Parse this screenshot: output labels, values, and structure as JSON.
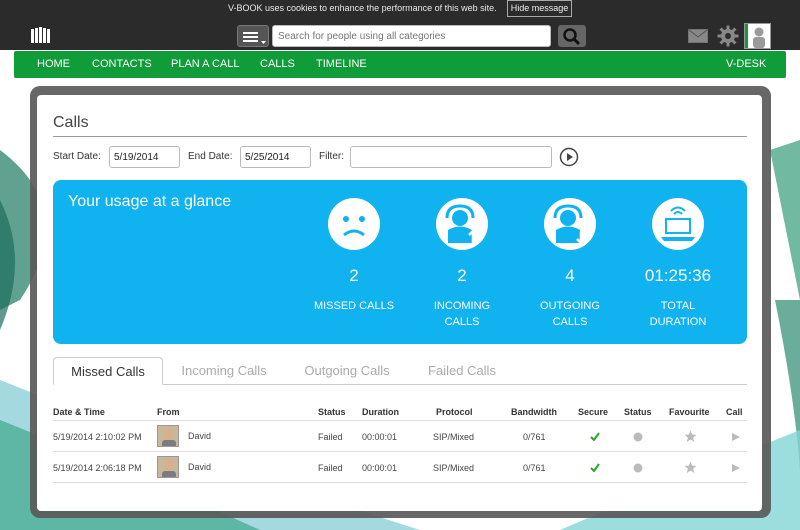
{
  "cookie": {
    "message": "V-BOOK uses cookies to enhance the performance of this web site.",
    "hide_label": "Hide message"
  },
  "search": {
    "placeholder": "Search for people using all categories"
  },
  "nav": {
    "items": [
      "HOME",
      "CONTACTS",
      "PLAN A CALL",
      "CALLS",
      "TIMELINE"
    ],
    "right": "V-DESK"
  },
  "page": {
    "title": "Calls"
  },
  "filters": {
    "start_label": "Start Date:",
    "start_value": "5/19/2014",
    "end_label": "End Date:",
    "end_value": "5/25/2014",
    "filter_label": "Filter:",
    "filter_value": ""
  },
  "usage": {
    "title": "Your usage at a glance",
    "stats": [
      {
        "value": "2",
        "label1": "MISSED CALLS",
        "label2": "",
        "icon": "sad-face-icon"
      },
      {
        "value": "2",
        "label1": "INCOMING",
        "label2": "CALLS",
        "icon": "incoming-call-icon"
      },
      {
        "value": "4",
        "label1": "OUTGOING",
        "label2": "CALLS",
        "icon": "outgoing-call-icon"
      },
      {
        "value": "01:25:36",
        "label1": "TOTAL",
        "label2": "DURATION",
        "icon": "laptop-signal-icon"
      }
    ]
  },
  "tabs": [
    "Missed Calls",
    "Incoming Calls",
    "Outgoing Calls",
    "Failed Calls"
  ],
  "table": {
    "headers": [
      "Date & Time",
      "From",
      "Status",
      "Duration",
      "Protocol",
      "Bandwidth",
      "Secure",
      "Status",
      "Favourite",
      "Call"
    ],
    "rows": [
      {
        "datetime": "5/19/2014 2:10:02 PM",
        "from": "David",
        "status": "Failed",
        "duration": "00:00:01",
        "protocol": "SIP/Mixed",
        "bandwidth": "0/761"
      },
      {
        "datetime": "5/19/2014 2:06:18 PM",
        "from": "David",
        "status": "Failed",
        "duration": "00:00:01",
        "protocol": "SIP/Mixed",
        "bandwidth": "0/761"
      }
    ]
  },
  "colors": {
    "nav_green": "#119c3a",
    "usage_blue": "#10b2ef",
    "secure_green": "#2aa52a"
  }
}
